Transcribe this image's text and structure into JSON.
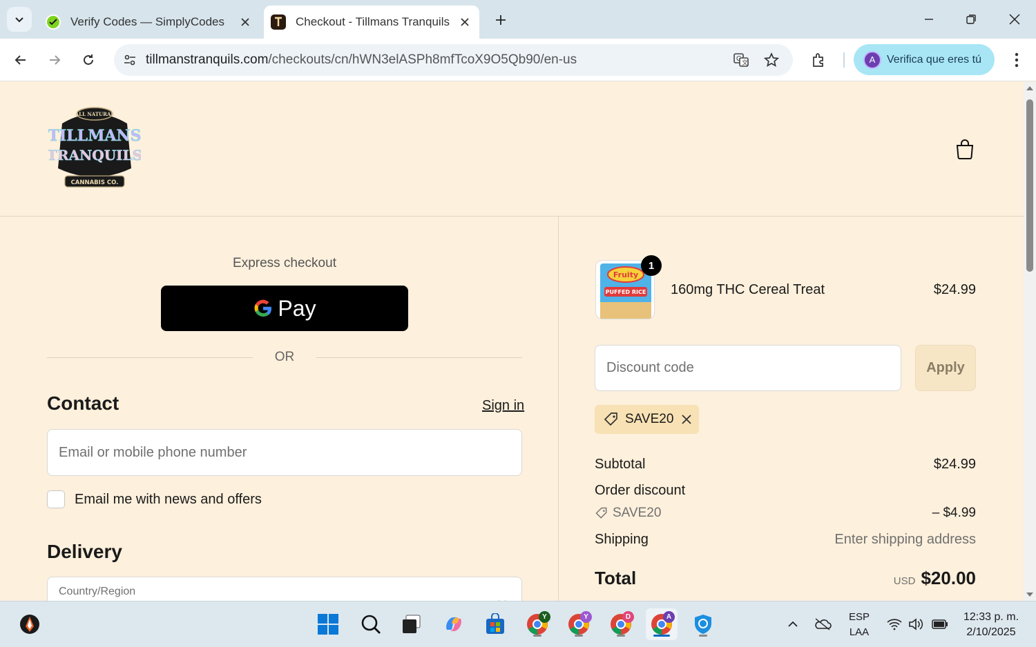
{
  "browser": {
    "tabs": [
      {
        "title": "Verify Codes — SimplyCodes",
        "active": false
      },
      {
        "title": "Checkout - Tillmans Tranquils",
        "active": true
      }
    ],
    "url_host": "tillmanstranquils.com",
    "url_path": "/checkouts/cn/hWN3elASPh8mfTcoX9O5Qb90/en-us",
    "profile_label": "Verifica que eres tú",
    "profile_initial": "A"
  },
  "store": {
    "logo_top": "ALL NATURAL",
    "logo_line1": "TILLMANS",
    "logo_line2": "TRANQUILS",
    "logo_bottom": "CANNABIS CO."
  },
  "checkout": {
    "express_label": "Express checkout",
    "gpay_label": "Pay",
    "or_label": "OR",
    "contact_heading": "Contact",
    "signin_label": "Sign in",
    "email_placeholder": "Email or mobile phone number",
    "newsletter_label": "Email me with news and offers",
    "delivery_heading": "Delivery",
    "country_label": "Country/Region"
  },
  "summary": {
    "item": {
      "name": "160mg THC Cereal Treat",
      "price": "$24.99",
      "qty": "1",
      "thumb_text1": "Fruity",
      "thumb_text2": "PUFFED RICE"
    },
    "discount_placeholder": "Discount code",
    "apply_label": "Apply",
    "applied_code": "SAVE20",
    "subtotal_label": "Subtotal",
    "subtotal_value": "$24.99",
    "order_discount_label": "Order discount",
    "discount_code": "SAVE20",
    "discount_value": "– $4.99",
    "shipping_label": "Shipping",
    "shipping_value": "Enter shipping address",
    "total_label": "Total",
    "currency": "USD",
    "total_value": "$20.00"
  },
  "taskbar": {
    "lang_top": "ESP",
    "lang_bottom": "LAA",
    "time": "12:33 p. m.",
    "date": "2/10/2025",
    "chrome_badges": [
      "Y",
      "Y",
      "D",
      "A"
    ]
  },
  "colors": {
    "accent_page": "#fdf0dc",
    "tabstrip": "#d7e4ec",
    "chip": "#f8e1b4"
  }
}
